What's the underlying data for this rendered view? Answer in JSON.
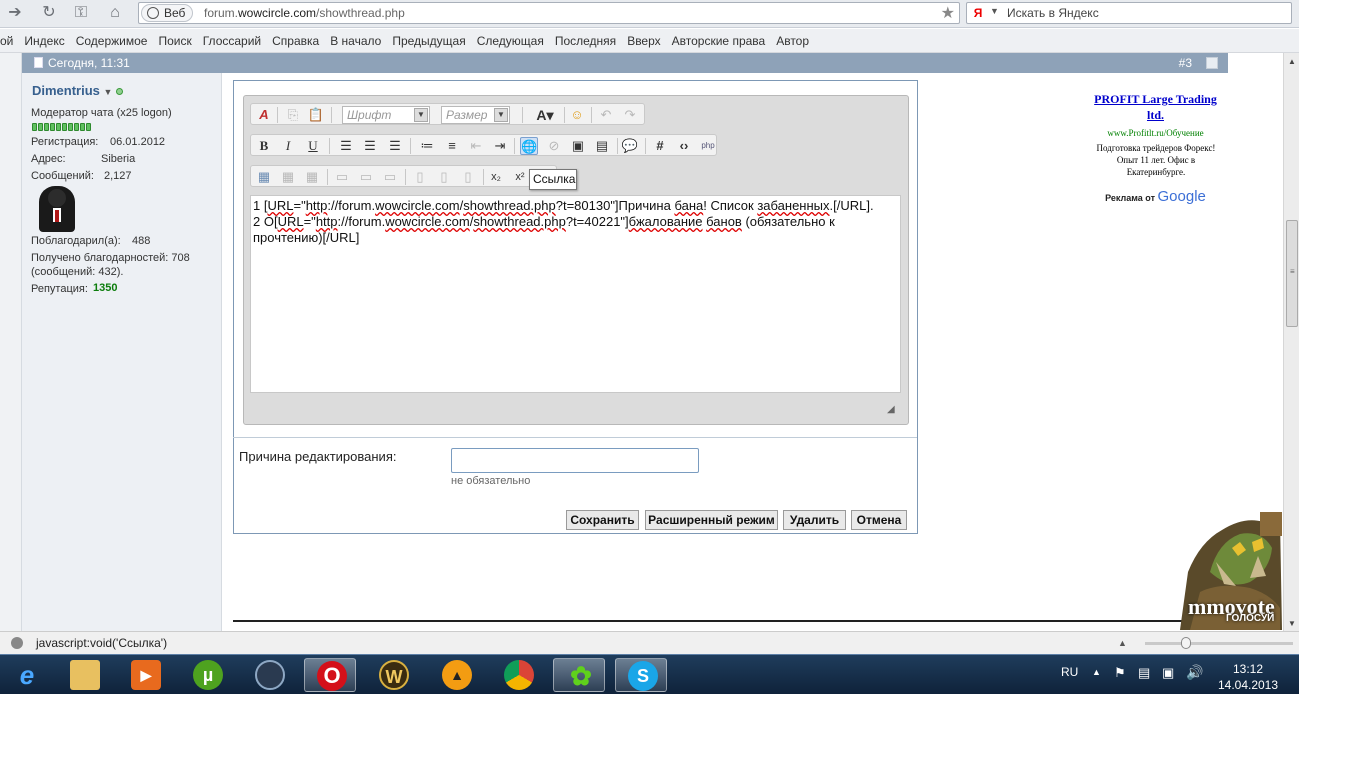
{
  "browser": {
    "web_tag": "Веб",
    "url_prefix": "forum.",
    "url_domain": "wowcircle.com",
    "url_path": "/showthread.php",
    "search_placeholder": "Искать в Яндекс"
  },
  "nav_menu": [
    "ой",
    "Индекс",
    "Содержимое",
    "Поиск",
    "Глоссарий",
    "Справка",
    "В начало",
    "Предыдущая",
    "Следующая",
    "Последняя",
    "Вверх",
    "Авторские права",
    "Автор"
  ],
  "post": {
    "date": "Сегодня, 11:31",
    "number": "#3"
  },
  "user": {
    "name": "Dimentrius",
    "title": "Модератор чата (x25 logon)",
    "reg_label": "Регистрация:",
    "reg_value": "06.01.2012",
    "addr_label": "Адрес:",
    "addr_value": "Siberia",
    "msgs_label": "Сообщений:",
    "msgs_value": "2,127",
    "thanked_label": "Поблагодарил(а):",
    "thanked_value": "488",
    "received_line1": "Получено благодарностей: 708",
    "received_line2": "(сообщений: 432).",
    "rep_label": "Репутация:",
    "rep_value": "1350"
  },
  "editor": {
    "font_placeholder": "Шрифт",
    "size_placeholder": "Размер",
    "tooltip": "Ссылка",
    "line1a": "1 [",
    "line1_url_tag": "URL",
    "line1b": "=\"",
    "line1_http": "http",
    "line1c": "://forum.",
    "line1_domain": "wowcircle.com",
    "line1d": "/",
    "line1_show": "showthread.php",
    "line1e": "?t=80130\"]Причина ",
    "line1_bana": "бана",
    "line1f": "! Список ",
    "line1_zab": "забаненных",
    "line1g": ".[/URL].",
    "line2a": "2 О[",
    "line2_url_tag": "URL",
    "line2b": "=\"",
    "line2_http": "http",
    "line2c": "://forum.",
    "line2_domain": "wowcircle.com",
    "line2d": "/",
    "line2_show": "showthread.php",
    "line2e": "?t=40221\"]",
    "line2_bzh": "бжалование",
    "line2f": " ",
    "line2_banov": "банов",
    "line2g": " (обязательно к прочтению)[/URL]"
  },
  "form": {
    "reason_label": "Причина редактирования:",
    "reason_value": "",
    "optional": "не обязательно",
    "save": "Сохранить",
    "advanced": "Расширенный режим",
    "delete": "Удалить",
    "cancel": "Отмена"
  },
  "ad": {
    "title": "PROFIT Large Trading ltd.",
    "url": "www.Profitlt.ru/Обучение",
    "text": "Подготовка трейдеров Форекс! Опыт 11 лет. Офис в Екатеринбурге.",
    "by": "Реклама от",
    "google": "Google"
  },
  "mmovote": {
    "brand": "mmovote",
    "sub": "ГОЛОСУЙ"
  },
  "status_bar": {
    "text": "javascript:void('Ссылка')"
  },
  "taskbar": {
    "lang": "RU",
    "time": "13:12",
    "date": "14.04.2013",
    "apps": [
      "internet-explorer",
      "file-explorer",
      "media-player",
      "utorrent",
      "teamspeak",
      "opera",
      "world-of-warcraft",
      "avast",
      "chrome",
      "icq",
      "skype"
    ]
  }
}
